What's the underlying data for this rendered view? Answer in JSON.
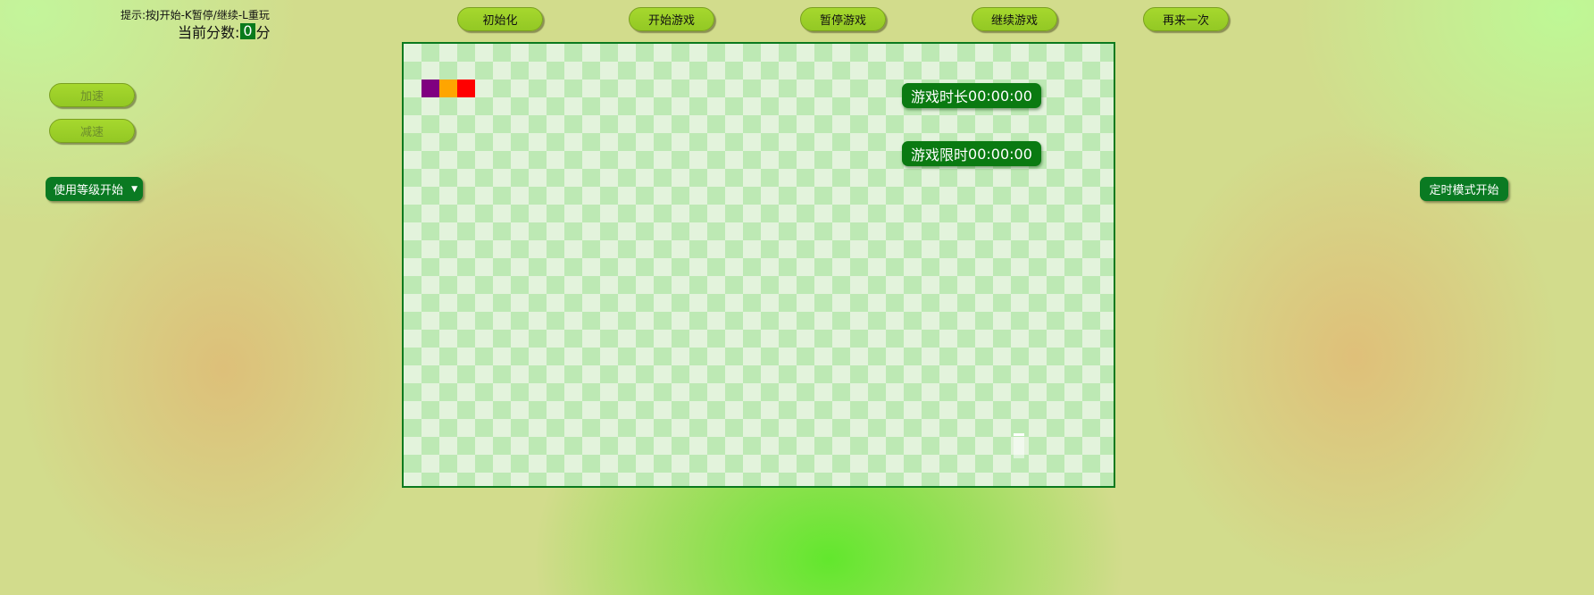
{
  "hint": "提示:按J开始-K暂停/继续-L重玩",
  "score": {
    "prefix": "当前分数:",
    "value": "0",
    "suffix": "分"
  },
  "toolbar": {
    "init_label": "初始化",
    "start_label": "开始游戏",
    "pause_label": "暂停游戏",
    "resume_label": "继续游戏",
    "replay_label": "再来一次"
  },
  "side": {
    "speed_up_label": "加速",
    "speed_down_label": "减速",
    "level_select_label": "使用等级开始",
    "level_select_arrow": "▼",
    "timed_mode_label": "定时模式开始"
  },
  "board": {
    "elapsed_label": "游戏时长",
    "elapsed_value": "00:00:00",
    "limit_label": "游戏限时",
    "limit_value": "00:00:00",
    "snake_colors": [
      "#800080",
      "#ffa500",
      "#ff0000"
    ]
  },
  "colors": {
    "pill_green": "#9acd32",
    "dark_green": "#0a7a22",
    "board_border": "#0b7a1e"
  }
}
